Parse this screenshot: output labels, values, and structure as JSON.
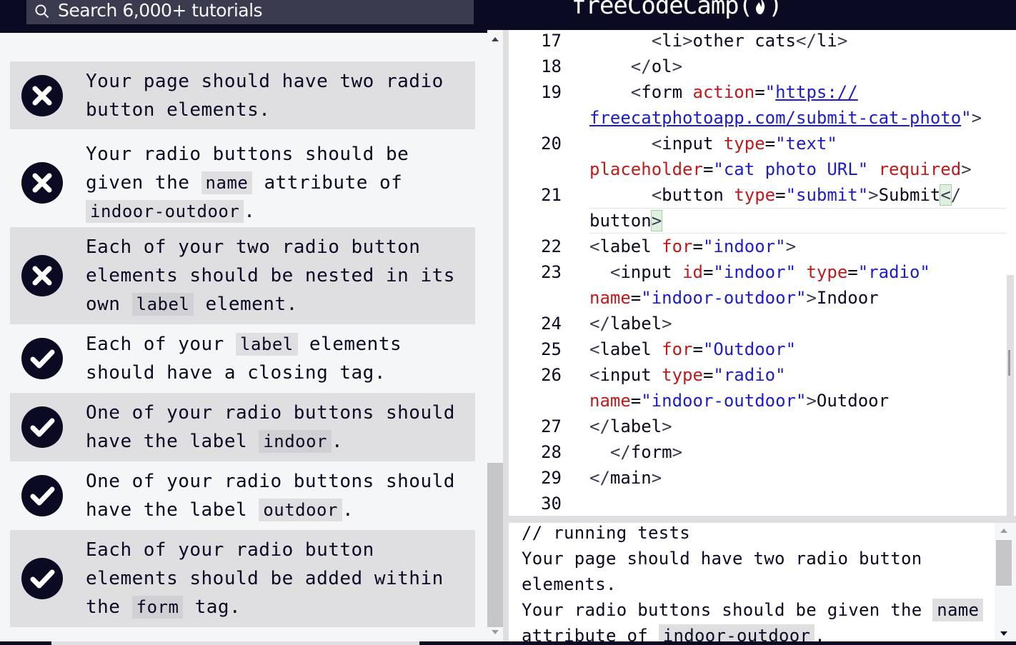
{
  "header": {
    "search_placeholder": "Search 6,000+ tutorials",
    "brand_text": "freeCodeCamp",
    "brand_icon": "flame-icon"
  },
  "tests": [
    {
      "status": "fail",
      "icon": "x-circle-icon",
      "parts": [
        {
          "t": "Your page should have two radio button elements."
        }
      ]
    },
    {
      "status": "fail",
      "icon": "x-circle-icon",
      "parts": [
        {
          "t": "Your radio buttons should be given the "
        },
        {
          "c": "name"
        },
        {
          "t": " attribute of "
        },
        {
          "c": "indoor-outdoor"
        },
        {
          "t": "."
        }
      ]
    },
    {
      "status": "fail",
      "icon": "x-circle-icon",
      "parts": [
        {
          "t": "Each of your two radio button elements should be nested in its own "
        },
        {
          "c": "label"
        },
        {
          "t": " element."
        }
      ]
    },
    {
      "status": "pass",
      "icon": "check-circle-icon",
      "parts": [
        {
          "t": "Each of your "
        },
        {
          "c": "label"
        },
        {
          "t": " elements should have a closing tag."
        }
      ]
    },
    {
      "status": "pass",
      "icon": "check-circle-icon",
      "parts": [
        {
          "t": "One of your radio buttons should have the label "
        },
        {
          "c": "indoor"
        },
        {
          "t": "."
        }
      ]
    },
    {
      "status": "pass",
      "icon": "check-circle-icon",
      "parts": [
        {
          "t": "One of your radio buttons should have the label "
        },
        {
          "c": "outdoor"
        },
        {
          "t": "."
        }
      ]
    },
    {
      "status": "pass",
      "icon": "check-circle-icon",
      "parts": [
        {
          "t": "Each of your radio button elements should be added within the "
        },
        {
          "c": "form"
        },
        {
          "t": " tag."
        }
      ]
    }
  ],
  "editor": {
    "line_numbers": [
      "17",
      "18",
      "19",
      "20",
      "21",
      "22",
      "23",
      "24",
      "25",
      "26",
      "27",
      "28",
      "29",
      "30"
    ],
    "code_rows": [
      [
        {
          "k": "b",
          "s": "      <"
        },
        {
          "k": "g",
          "s": "li"
        },
        {
          "k": "b",
          "s": ">"
        },
        {
          "k": "x",
          "s": "other cats"
        },
        {
          "k": "b",
          "s": "</"
        },
        {
          "k": "g",
          "s": "li"
        },
        {
          "k": "b",
          "s": ">"
        }
      ],
      [
        {
          "k": "b",
          "s": "    </"
        },
        {
          "k": "g",
          "s": "ol"
        },
        {
          "k": "b",
          "s": ">"
        }
      ],
      [
        {
          "k": "b",
          "s": "    <"
        },
        {
          "k": "g",
          "s": "form"
        },
        {
          "k": "x",
          "s": " "
        },
        {
          "k": "a",
          "s": "action"
        },
        {
          "k": "x",
          "s": "="
        },
        {
          "k": "s",
          "s": "\""
        },
        {
          "k": "l",
          "s": "https://"
        }
      ],
      [
        {
          "k": "l",
          "s": "freecatphotoapp.com/submit-cat-photo"
        },
        {
          "k": "s",
          "s": "\""
        },
        {
          "k": "b",
          "s": ">"
        }
      ],
      [
        {
          "k": "b",
          "s": "      <"
        },
        {
          "k": "g",
          "s": "input"
        },
        {
          "k": "x",
          "s": " "
        },
        {
          "k": "a",
          "s": "type"
        },
        {
          "k": "x",
          "s": "="
        },
        {
          "k": "s",
          "s": "\"text\""
        }
      ],
      [
        {
          "k": "a",
          "s": "placeholder"
        },
        {
          "k": "x",
          "s": "="
        },
        {
          "k": "s",
          "s": "\"cat photo URL\""
        },
        {
          "k": "x",
          "s": " "
        },
        {
          "k": "a",
          "s": "required"
        },
        {
          "k": "b",
          "s": ">"
        }
      ],
      [
        {
          "k": "b",
          "s": "      <"
        },
        {
          "k": "g",
          "s": "button"
        },
        {
          "k": "x",
          "s": " "
        },
        {
          "k": "a",
          "s": "type"
        },
        {
          "k": "x",
          "s": "="
        },
        {
          "k": "s",
          "s": "\"submit\""
        },
        {
          "k": "b",
          "s": ">"
        },
        {
          "k": "x",
          "s": "Submit"
        },
        {
          "k": "m",
          "s": "<"
        },
        {
          "k": "b",
          "s": "/"
        }
      ],
      [
        {
          "k": "g",
          "s": "button"
        },
        {
          "k": "m",
          "s": ">"
        }
      ],
      [
        {
          "k": "b",
          "s": "<"
        },
        {
          "k": "g",
          "s": "label"
        },
        {
          "k": "x",
          "s": " "
        },
        {
          "k": "a",
          "s": "for"
        },
        {
          "k": "x",
          "s": "="
        },
        {
          "k": "s",
          "s": "\"indoor\""
        },
        {
          "k": "b",
          "s": ">"
        }
      ],
      [
        {
          "k": "b",
          "s": "  <"
        },
        {
          "k": "g",
          "s": "input"
        },
        {
          "k": "x",
          "s": " "
        },
        {
          "k": "a",
          "s": "id"
        },
        {
          "k": "x",
          "s": "="
        },
        {
          "k": "s",
          "s": "\"indoor\""
        },
        {
          "k": "x",
          "s": " "
        },
        {
          "k": "a",
          "s": "type"
        },
        {
          "k": "x",
          "s": "="
        },
        {
          "k": "s",
          "s": "\"radio\""
        }
      ],
      [
        {
          "k": "a",
          "s": "name"
        },
        {
          "k": "x",
          "s": "="
        },
        {
          "k": "s",
          "s": "\"indoor-outdoor\""
        },
        {
          "k": "b",
          "s": ">"
        },
        {
          "k": "x",
          "s": "Indoor"
        }
      ],
      [
        {
          "k": "b",
          "s": "</"
        },
        {
          "k": "g",
          "s": "label"
        },
        {
          "k": "b",
          "s": ">"
        }
      ],
      [
        {
          "k": "b",
          "s": "<"
        },
        {
          "k": "g",
          "s": "label"
        },
        {
          "k": "x",
          "s": " "
        },
        {
          "k": "a",
          "s": "for"
        },
        {
          "k": "x",
          "s": "="
        },
        {
          "k": "s",
          "s": "\"Outdoor\""
        }
      ],
      [
        {
          "k": "b",
          "s": "<"
        },
        {
          "k": "g",
          "s": "input"
        },
        {
          "k": "x",
          "s": " "
        },
        {
          "k": "a",
          "s": "type"
        },
        {
          "k": "x",
          "s": "="
        },
        {
          "k": "s",
          "s": "\"radio\""
        }
      ],
      [
        {
          "k": "a",
          "s": "name"
        },
        {
          "k": "x",
          "s": "="
        },
        {
          "k": "s",
          "s": "\"indoor-outdoor\""
        },
        {
          "k": "b",
          "s": ">"
        },
        {
          "k": "x",
          "s": "Outdoor"
        }
      ],
      [
        {
          "k": "b",
          "s": "</"
        },
        {
          "k": "g",
          "s": "label"
        },
        {
          "k": "b",
          "s": ">"
        }
      ],
      [
        {
          "k": "b",
          "s": "  </"
        },
        {
          "k": "g",
          "s": "form"
        },
        {
          "k": "b",
          "s": ">"
        }
      ],
      [
        {
          "k": "b",
          "s": "</"
        },
        {
          "k": "g",
          "s": "main"
        },
        {
          "k": "b",
          "s": ">"
        }
      ],
      []
    ]
  },
  "console": {
    "rows": [
      [
        {
          "t": "// running tests"
        }
      ],
      [
        {
          "t": "Your page should have two radio button"
        }
      ],
      [
        {
          "t": "elements."
        }
      ],
      [
        {
          "t": "Your radio buttons should be given the "
        },
        {
          "c": "name"
        }
      ],
      [
        {
          "t": "attribute of "
        },
        {
          "c": "indoor-outdoor"
        },
        {
          "t": "."
        }
      ]
    ]
  },
  "colors": {
    "nav_bg": "#0a0a23",
    "search_bg": "#3b3b4f",
    "pass_fail_icon": "#0a0a23",
    "attr_red": "#c11a1a",
    "string_blue": "#1c1cc9"
  }
}
